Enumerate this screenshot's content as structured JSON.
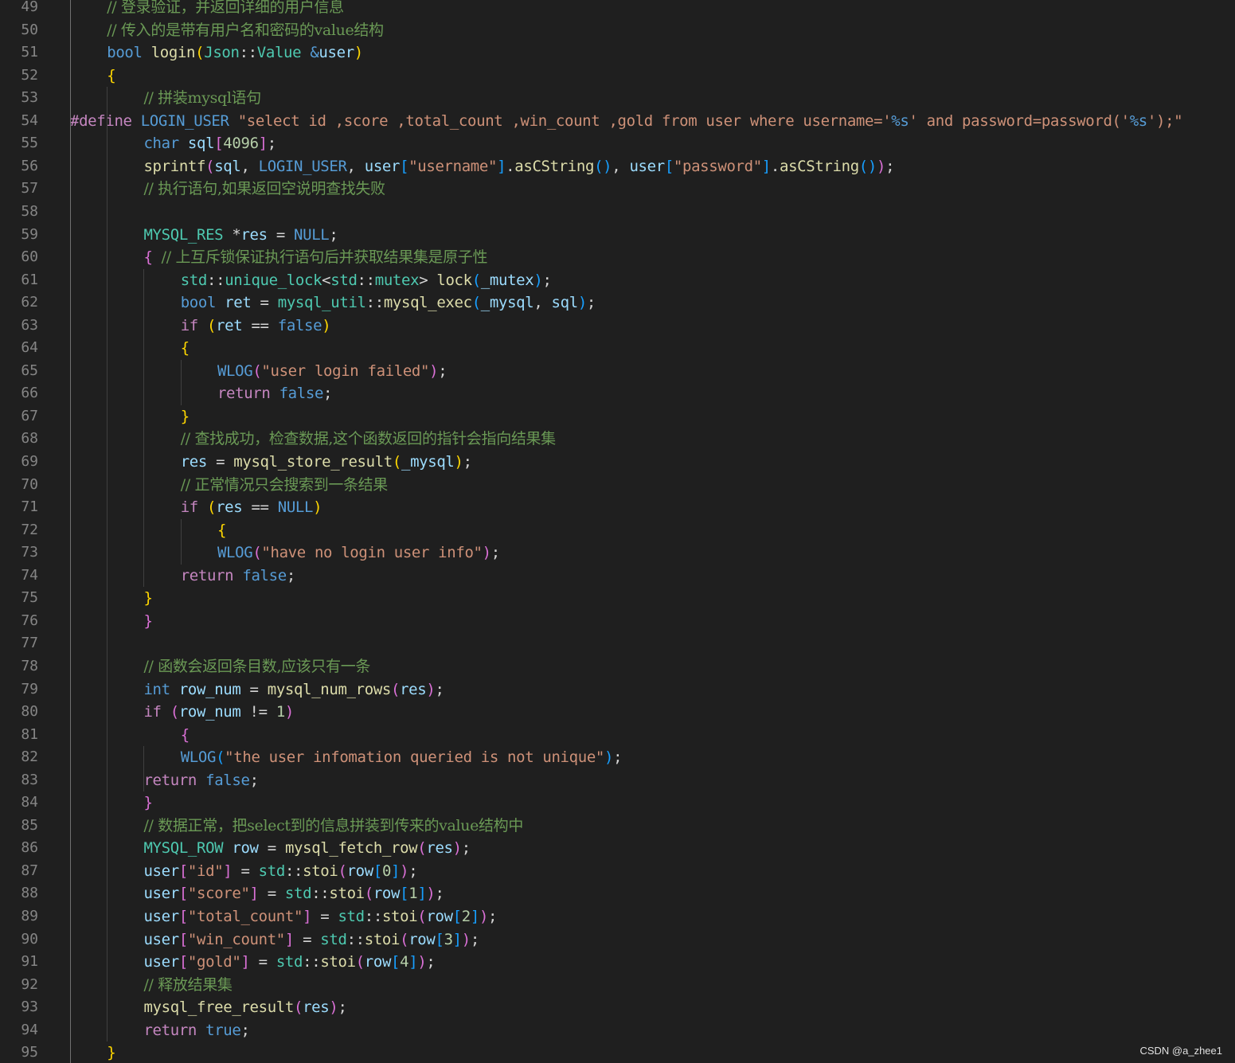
{
  "editor": {
    "lines": [
      {
        "n": "49",
        "tokens": [
          [
            "cmt",
            "// 登录验证，并返回详细的用户信息"
          ]
        ]
      },
      {
        "n": "50",
        "tokens": [
          [
            "cmt",
            "// 传入的是带有用户名和密码的value结构"
          ]
        ]
      },
      {
        "n": "51",
        "tokens": [
          [
            "kw",
            "bool"
          ],
          [
            "pun",
            " "
          ],
          [
            "fn",
            "login"
          ],
          [
            "b1",
            "("
          ],
          [
            "ty",
            "Json"
          ],
          [
            "pun",
            "::"
          ],
          [
            "ty",
            "Value"
          ],
          [
            "pun",
            " "
          ],
          [
            "kw",
            "&"
          ],
          [
            "var",
            "user"
          ],
          [
            "b1",
            ")"
          ]
        ]
      },
      {
        "n": "52",
        "tokens": [
          [
            "b1",
            "{"
          ]
        ]
      },
      {
        "n": "53",
        "tokens": [
          [
            "cmt",
            "// 拼装mysql语句"
          ]
        ]
      },
      {
        "n": "54",
        "tokens": [
          [
            "pp",
            "#define"
          ],
          [
            "pun",
            " "
          ],
          [
            "mac",
            "LOGIN_USER"
          ],
          [
            "pun",
            " "
          ],
          [
            "str",
            "\"select id ,score ,total_count ,win_count ,gold from user where username='"
          ],
          [
            "kw",
            "%s"
          ],
          [
            "str",
            "' and password=password('"
          ],
          [
            "kw",
            "%s"
          ],
          [
            "str",
            "');\""
          ]
        ]
      },
      {
        "n": "55",
        "tokens": [
          [
            "kw",
            "char"
          ],
          [
            "pun",
            " "
          ],
          [
            "var",
            "sql"
          ],
          [
            "b2",
            "["
          ],
          [
            "num",
            "4096"
          ],
          [
            "b2",
            "]"
          ],
          [
            "pun",
            ";"
          ]
        ]
      },
      {
        "n": "56",
        "tokens": [
          [
            "fn",
            "sprintf"
          ],
          [
            "b2",
            "("
          ],
          [
            "var",
            "sql"
          ],
          [
            "pun",
            ", "
          ],
          [
            "mac",
            "LOGIN_USER"
          ],
          [
            "pun",
            ", "
          ],
          [
            "var",
            "user"
          ],
          [
            "b3",
            "["
          ],
          [
            "str",
            "\"username\""
          ],
          [
            "b3",
            "]"
          ],
          [
            "pun",
            "."
          ],
          [
            "fn",
            "asCString"
          ],
          [
            "b3",
            "()"
          ],
          [
            "pun",
            ", "
          ],
          [
            "var",
            "user"
          ],
          [
            "b3",
            "["
          ],
          [
            "str",
            "\"password\""
          ],
          [
            "b3",
            "]"
          ],
          [
            "pun",
            "."
          ],
          [
            "fn",
            "asCString"
          ],
          [
            "b3",
            "()"
          ],
          [
            "b2",
            ")"
          ],
          [
            "pun",
            ";"
          ]
        ]
      },
      {
        "n": "57",
        "tokens": [
          [
            "cmt",
            "// 执行语句,如果返回空说明查找失败"
          ]
        ]
      },
      {
        "n": "58",
        "tokens": []
      },
      {
        "n": "59",
        "tokens": [
          [
            "ty",
            "MYSQL_RES"
          ],
          [
            "pun",
            " *"
          ],
          [
            "var",
            "res"
          ],
          [
            "pun",
            " = "
          ],
          [
            "kw",
            "NULL"
          ],
          [
            "pun",
            ";"
          ]
        ]
      },
      {
        "n": "60",
        "tokens": [
          [
            "b2",
            "{"
          ],
          [
            "pun",
            " "
          ],
          [
            "cmt",
            "// 上互斥锁保证执行语句后并获取结果集是原子性"
          ]
        ]
      },
      {
        "n": "61",
        "tokens": [
          [
            "ty",
            "std"
          ],
          [
            "pun",
            "::"
          ],
          [
            "ty",
            "unique_lock"
          ],
          [
            "pun",
            "<"
          ],
          [
            "ty",
            "std"
          ],
          [
            "pun",
            "::"
          ],
          [
            "ty",
            "mutex"
          ],
          [
            "pun",
            "> "
          ],
          [
            "fn",
            "lock"
          ],
          [
            "b3",
            "("
          ],
          [
            "var",
            "_mutex"
          ],
          [
            "b3",
            ")"
          ],
          [
            "pun",
            ";"
          ]
        ]
      },
      {
        "n": "62",
        "tokens": [
          [
            "kw",
            "bool"
          ],
          [
            "pun",
            " "
          ],
          [
            "var",
            "ret"
          ],
          [
            "pun",
            " = "
          ],
          [
            "ty",
            "mysql_util"
          ],
          [
            "pun",
            "::"
          ],
          [
            "fn",
            "mysql_exec"
          ],
          [
            "b3",
            "("
          ],
          [
            "var",
            "_mysql"
          ],
          [
            "pun",
            ", "
          ],
          [
            "var",
            "sql"
          ],
          [
            "b3",
            ")"
          ],
          [
            "pun",
            ";"
          ]
        ]
      },
      {
        "n": "63",
        "tokens": [
          [
            "ctl",
            "if"
          ],
          [
            "pun",
            " "
          ],
          [
            "b1",
            "("
          ],
          [
            "var",
            "ret"
          ],
          [
            "pun",
            " == "
          ],
          [
            "kw",
            "false"
          ],
          [
            "b1",
            ")"
          ]
        ]
      },
      {
        "n": "64",
        "tokens": [
          [
            "b1",
            "{"
          ]
        ]
      },
      {
        "n": "65",
        "tokens": [
          [
            "mac",
            "WLOG"
          ],
          [
            "b2",
            "("
          ],
          [
            "str",
            "\"user login failed\""
          ],
          [
            "b2",
            ")"
          ],
          [
            "pun",
            ";"
          ]
        ]
      },
      {
        "n": "66",
        "tokens": [
          [
            "ctl",
            "return"
          ],
          [
            "pun",
            " "
          ],
          [
            "kw",
            "false"
          ],
          [
            "pun",
            ";"
          ]
        ]
      },
      {
        "n": "67",
        "tokens": [
          [
            "b1",
            "}"
          ]
        ]
      },
      {
        "n": "68",
        "tokens": [
          [
            "cmt",
            "// 查找成功，检查数据,这个函数返回的指针会指向结果集"
          ]
        ]
      },
      {
        "n": "69",
        "tokens": [
          [
            "var",
            "res"
          ],
          [
            "pun",
            " = "
          ],
          [
            "fn",
            "mysql_store_result"
          ],
          [
            "b1",
            "("
          ],
          [
            "var",
            "_mysql"
          ],
          [
            "b1",
            ")"
          ],
          [
            "pun",
            ";"
          ]
        ]
      },
      {
        "n": "70",
        "tokens": [
          [
            "cmt",
            "// 正常情况只会搜索到一条结果"
          ]
        ]
      },
      {
        "n": "71",
        "tokens": [
          [
            "ctl",
            "if"
          ],
          [
            "pun",
            " "
          ],
          [
            "b1",
            "("
          ],
          [
            "var",
            "res"
          ],
          [
            "pun",
            " == "
          ],
          [
            "kw",
            "NULL"
          ],
          [
            "b1",
            ")"
          ]
        ]
      },
      {
        "n": "72",
        "tokens": [
          [
            "b1",
            "{"
          ]
        ]
      },
      {
        "n": "73",
        "tokens": [
          [
            "mac",
            "WLOG"
          ],
          [
            "b2",
            "("
          ],
          [
            "str",
            "\"have no login user info\""
          ],
          [
            "b2",
            ")"
          ],
          [
            "pun",
            ";"
          ]
        ]
      },
      {
        "n": "74",
        "tokens": [
          [
            "ctl",
            "return"
          ],
          [
            "pun",
            " "
          ],
          [
            "kw",
            "false"
          ],
          [
            "pun",
            ";"
          ]
        ]
      },
      {
        "n": "75",
        "tokens": [
          [
            "b1",
            "}"
          ]
        ]
      },
      {
        "n": "76",
        "tokens": [
          [
            "b2",
            "}"
          ]
        ]
      },
      {
        "n": "77",
        "tokens": []
      },
      {
        "n": "78",
        "tokens": [
          [
            "cmt",
            "// 函数会返回条目数,应该只有一条"
          ]
        ]
      },
      {
        "n": "79",
        "tokens": [
          [
            "kw",
            "int"
          ],
          [
            "pun",
            " "
          ],
          [
            "var",
            "row_num"
          ],
          [
            "pun",
            " = "
          ],
          [
            "fn",
            "mysql_num_rows"
          ],
          [
            "b2",
            "("
          ],
          [
            "var",
            "res"
          ],
          [
            "b2",
            ")"
          ],
          [
            "pun",
            ";"
          ]
        ]
      },
      {
        "n": "80",
        "tokens": [
          [
            "ctl",
            "if"
          ],
          [
            "pun",
            " "
          ],
          [
            "b2",
            "("
          ],
          [
            "var",
            "row_num"
          ],
          [
            "pun",
            " != "
          ],
          [
            "num",
            "1"
          ],
          [
            "b2",
            ")"
          ]
        ]
      },
      {
        "n": "81",
        "tokens": [
          [
            "b2",
            "{"
          ]
        ]
      },
      {
        "n": "82",
        "tokens": [
          [
            "mac",
            "WLOG"
          ],
          [
            "b3",
            "("
          ],
          [
            "str",
            "\"the user infomation queried is not unique\""
          ],
          [
            "b3",
            ")"
          ],
          [
            "pun",
            ";"
          ]
        ]
      },
      {
        "n": "83",
        "tokens": [
          [
            "ctl",
            "return"
          ],
          [
            "pun",
            " "
          ],
          [
            "kw",
            "false"
          ],
          [
            "pun",
            ";"
          ]
        ]
      },
      {
        "n": "84",
        "tokens": [
          [
            "b2",
            "}"
          ]
        ]
      },
      {
        "n": "85",
        "tokens": [
          [
            "cmt",
            "// 数据正常，把select到的信息拼装到传来的value结构中"
          ]
        ]
      },
      {
        "n": "86",
        "tokens": [
          [
            "ty",
            "MYSQL_ROW"
          ],
          [
            "pun",
            " "
          ],
          [
            "var",
            "row"
          ],
          [
            "pun",
            " = "
          ],
          [
            "fn",
            "mysql_fetch_row"
          ],
          [
            "b2",
            "("
          ],
          [
            "var",
            "res"
          ],
          [
            "b2",
            ")"
          ],
          [
            "pun",
            ";"
          ]
        ]
      },
      {
        "n": "87",
        "tokens": [
          [
            "var",
            "user"
          ],
          [
            "b2",
            "["
          ],
          [
            "str",
            "\"id\""
          ],
          [
            "b2",
            "]"
          ],
          [
            "pun",
            " = "
          ],
          [
            "ty",
            "std"
          ],
          [
            "pun",
            "::"
          ],
          [
            "fn",
            "stoi"
          ],
          [
            "b2",
            "("
          ],
          [
            "var",
            "row"
          ],
          [
            "b3",
            "["
          ],
          [
            "num",
            "0"
          ],
          [
            "b3",
            "]"
          ],
          [
            "b2",
            ")"
          ],
          [
            "pun",
            ";"
          ]
        ]
      },
      {
        "n": "88",
        "tokens": [
          [
            "var",
            "user"
          ],
          [
            "b2",
            "["
          ],
          [
            "str",
            "\"score\""
          ],
          [
            "b2",
            "]"
          ],
          [
            "pun",
            " = "
          ],
          [
            "ty",
            "std"
          ],
          [
            "pun",
            "::"
          ],
          [
            "fn",
            "stoi"
          ],
          [
            "b2",
            "("
          ],
          [
            "var",
            "row"
          ],
          [
            "b3",
            "["
          ],
          [
            "num",
            "1"
          ],
          [
            "b3",
            "]"
          ],
          [
            "b2",
            ")"
          ],
          [
            "pun",
            ";"
          ]
        ]
      },
      {
        "n": "89",
        "tokens": [
          [
            "var",
            "user"
          ],
          [
            "b2",
            "["
          ],
          [
            "str",
            "\"total_count\""
          ],
          [
            "b2",
            "]"
          ],
          [
            "pun",
            " = "
          ],
          [
            "ty",
            "std"
          ],
          [
            "pun",
            "::"
          ],
          [
            "fn",
            "stoi"
          ],
          [
            "b2",
            "("
          ],
          [
            "var",
            "row"
          ],
          [
            "b3",
            "["
          ],
          [
            "num",
            "2"
          ],
          [
            "b3",
            "]"
          ],
          [
            "b2",
            ")"
          ],
          [
            "pun",
            ";"
          ]
        ]
      },
      {
        "n": "90",
        "tokens": [
          [
            "var",
            "user"
          ],
          [
            "b2",
            "["
          ],
          [
            "str",
            "\"win_count\""
          ],
          [
            "b2",
            "]"
          ],
          [
            "pun",
            " = "
          ],
          [
            "ty",
            "std"
          ],
          [
            "pun",
            "::"
          ],
          [
            "fn",
            "stoi"
          ],
          [
            "b2",
            "("
          ],
          [
            "var",
            "row"
          ],
          [
            "b3",
            "["
          ],
          [
            "num",
            "3"
          ],
          [
            "b3",
            "]"
          ],
          [
            "b2",
            ")"
          ],
          [
            "pun",
            ";"
          ]
        ]
      },
      {
        "n": "91",
        "tokens": [
          [
            "var",
            "user"
          ],
          [
            "b2",
            "["
          ],
          [
            "str",
            "\"gold\""
          ],
          [
            "b2",
            "]"
          ],
          [
            "pun",
            " = "
          ],
          [
            "ty",
            "std"
          ],
          [
            "pun",
            "::"
          ],
          [
            "fn",
            "stoi"
          ],
          [
            "b2",
            "("
          ],
          [
            "var",
            "row"
          ],
          [
            "b3",
            "["
          ],
          [
            "num",
            "4"
          ],
          [
            "b3",
            "]"
          ],
          [
            "b2",
            ")"
          ],
          [
            "pun",
            ";"
          ]
        ]
      },
      {
        "n": "92",
        "tokens": [
          [
            "cmt",
            "// 释放结果集"
          ]
        ]
      },
      {
        "n": "93",
        "tokens": [
          [
            "fn",
            "mysql_free_result"
          ],
          [
            "b2",
            "("
          ],
          [
            "var",
            "res"
          ],
          [
            "b2",
            ")"
          ],
          [
            "pun",
            ";"
          ]
        ]
      },
      {
        "n": "94",
        "tokens": [
          [
            "ctl",
            "return"
          ],
          [
            "pun",
            " "
          ],
          [
            "kw",
            "true"
          ],
          [
            "pun",
            ";"
          ]
        ]
      },
      {
        "n": "95",
        "tokens": [
          [
            "b1",
            "}"
          ]
        ]
      }
    ]
  },
  "watermark": "CSDN @a_zhee1",
  "colors": {
    "background": "#1f1f1f",
    "line_number": "#858585",
    "keyword": "#569cd6",
    "control": "#c586c0",
    "function": "#dcdcaa",
    "type": "#4ec9b0",
    "string": "#ce9178",
    "variable": "#9cdcfe",
    "number": "#b5cea8",
    "comment": "#6a9955",
    "bracket_level1": "#ffd700",
    "bracket_level2": "#da70d6",
    "bracket_level3": "#179fff"
  }
}
